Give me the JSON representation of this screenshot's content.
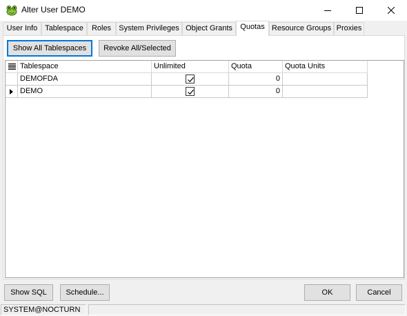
{
  "window": {
    "title": "Alter User DEMO",
    "icon": "frog-app-icon"
  },
  "tabs": [
    {
      "label": "User Info"
    },
    {
      "label": "Tablespace"
    },
    {
      "label": "Roles"
    },
    {
      "label": "System Privileges"
    },
    {
      "label": "Object Grants"
    },
    {
      "label": "Quotas",
      "active": true
    },
    {
      "label": "Resource Groups"
    },
    {
      "label": "Proxies"
    }
  ],
  "quotas": {
    "show_all_label": "Show All Tablespaces",
    "revoke_label": "Revoke All/Selected",
    "columns": [
      "Tablespace",
      "Unlimited",
      "Quota",
      "Quota Units"
    ],
    "rows": [
      {
        "tablespace": "DEMOFDA",
        "unlimited": true,
        "quota": "0",
        "quota_units": ""
      },
      {
        "tablespace": "DEMO",
        "unlimited": true,
        "quota": "0",
        "quota_units": "",
        "current": true
      }
    ]
  },
  "footer": {
    "show_sql_label": "Show SQL",
    "schedule_label": "Schedule...",
    "ok_label": "OK",
    "cancel_label": "Cancel"
  },
  "status": {
    "connection": "SYSTEM@NOCTURN",
    "message": ""
  },
  "colors": {
    "focus_border": "#0078d7",
    "window_bg": "#f0f0f0"
  }
}
